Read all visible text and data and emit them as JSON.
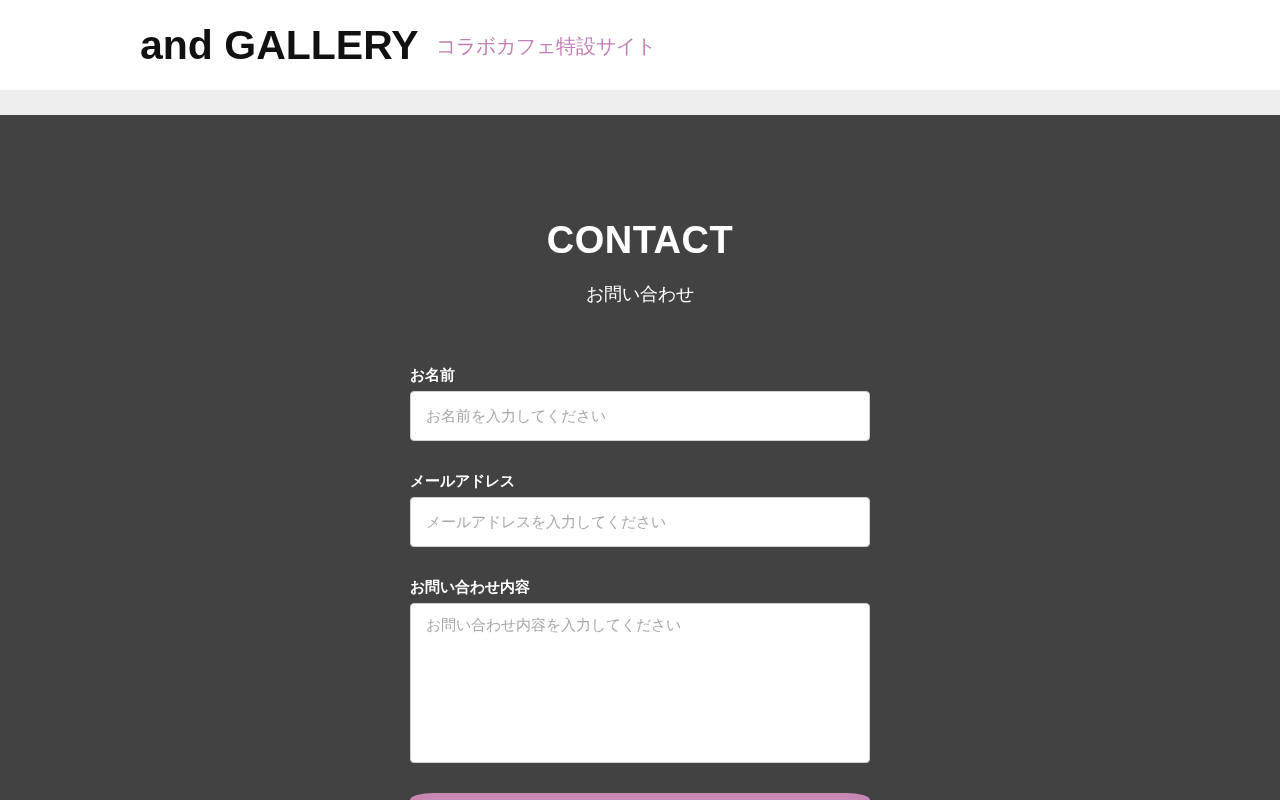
{
  "header": {
    "logo": "and GALLERY",
    "subtitle": "コラボカフェ特設サイト"
  },
  "contact": {
    "title": "CONTACT",
    "subtitle": "お問い合わせ",
    "fields": [
      {
        "kind": "input",
        "label": "お名前",
        "placeholder": "お名前を入力してください"
      },
      {
        "kind": "input",
        "label": "メールアドレス",
        "placeholder": "メールアドレスを入力してください"
      },
      {
        "kind": "textarea",
        "label": "お問い合わせ内容",
        "placeholder": "お問い合わせ内容を入力してください"
      }
    ]
  }
}
